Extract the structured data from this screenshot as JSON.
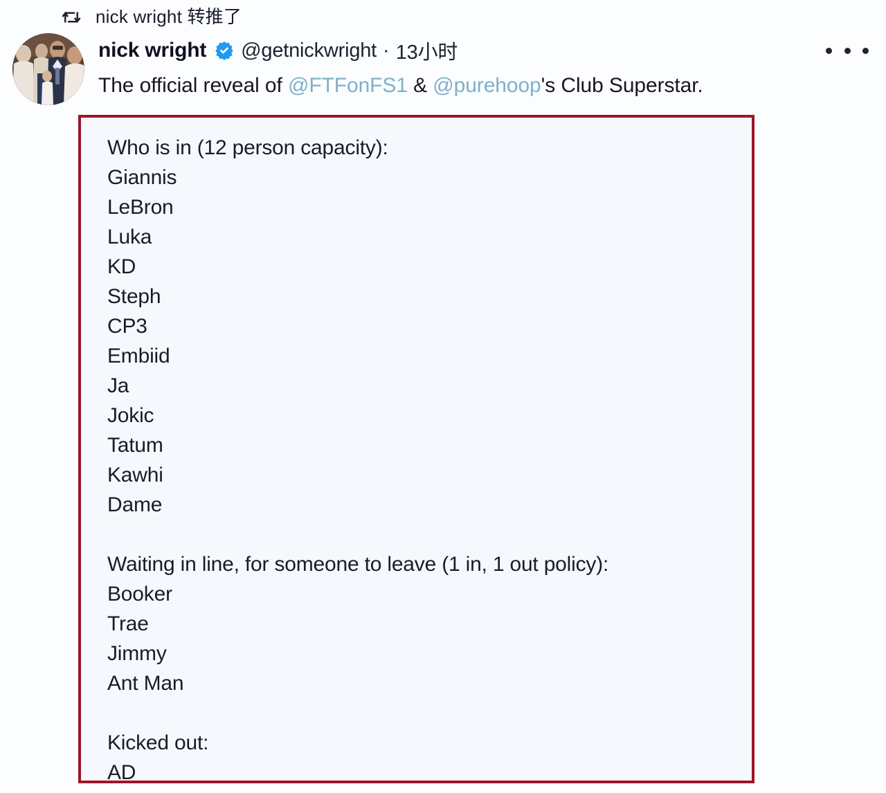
{
  "colors": {
    "page_background": "#fbfdfe",
    "box_border": "#9e142a",
    "box_background": "#f5f9fd",
    "verified_blue": "#1d9bf0",
    "mention_link": "#7fb0c9",
    "text": "#1b1b28"
  },
  "retweet": {
    "icon": "retweet-icon",
    "text": "nick wright 转推了"
  },
  "author": {
    "avatar_icon": "avatar-photo",
    "display_name": "nick wright",
    "verified_icon": "verified-badge-icon",
    "handle": "@getnickwright",
    "separator": "·",
    "timestamp": "13小时"
  },
  "more_menu": {
    "icon": "more-options-icon",
    "label": "More"
  },
  "tweet_text": {
    "prefix": "The official reveal of ",
    "mention_1": "@FTFonFS1",
    "middle": " & ",
    "mention_2": "@purehoop",
    "suffix": "'s Club Superstar."
  },
  "list_box": {
    "lines": [
      "Who is in (12 person capacity):",
      "Giannis",
      "LeBron",
      "Luka",
      "KD",
      "Steph",
      "CP3",
      "Embiid",
      "Ja",
      "Jokic",
      "Tatum",
      "Kawhi",
      "Dame",
      "",
      "Waiting in line, for someone to leave (1 in, 1 out policy):",
      "Booker",
      "Trae",
      "Jimmy",
      "Ant Man",
      "",
      "Kicked out:",
      "AD"
    ]
  }
}
